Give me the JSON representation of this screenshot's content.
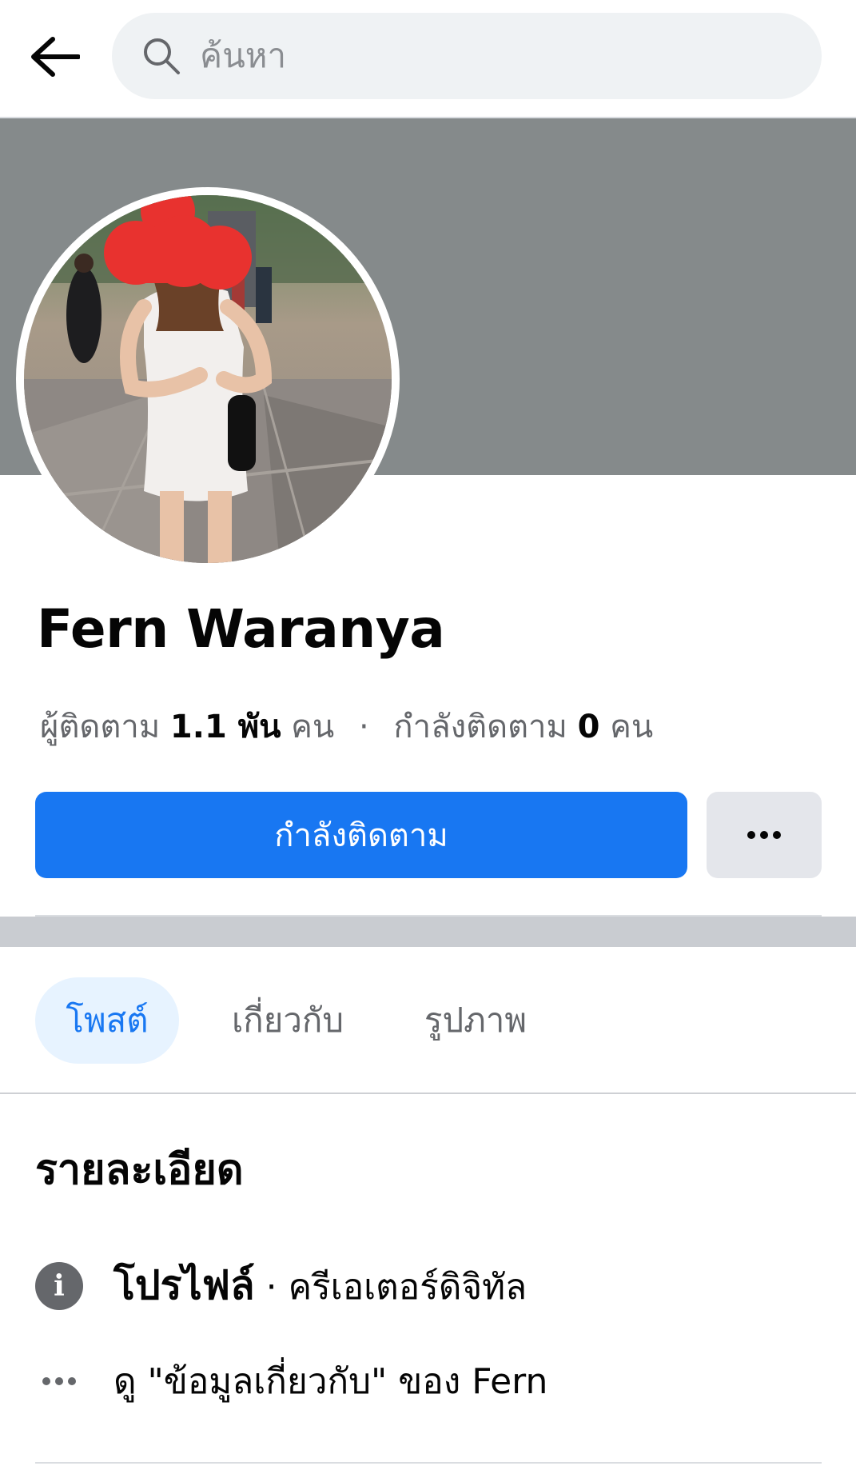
{
  "search": {
    "placeholder": "ค้นหา"
  },
  "profile": {
    "name": "Fern Waranya",
    "followers_label": "ผู้ติดตาม",
    "followers_count": "1.1 พัน",
    "followers_unit": "คน",
    "separator": "·",
    "following_label": "กำลังติดตาม",
    "following_count": "0",
    "following_unit": "คน"
  },
  "actions": {
    "follow_label": "กำลังติดตาม"
  },
  "tabs": [
    {
      "label": "โพสต์",
      "active": true
    },
    {
      "label": "เกี่ยวกับ",
      "active": false
    },
    {
      "label": "รูปภาพ",
      "active": false
    }
  ],
  "details": {
    "title": "รายละเอียด",
    "profile_type_label": "โปรไฟล์",
    "profile_type_value": "· ครีเอเตอร์ดิจิทัล",
    "see_about": "ดู \"ข้อมูลเกี่ยวกับ\" ของ Fern"
  },
  "colors": {
    "accent": "#1877f2",
    "cover": "#858a8b",
    "avatar_redaction": "#e8322f"
  }
}
